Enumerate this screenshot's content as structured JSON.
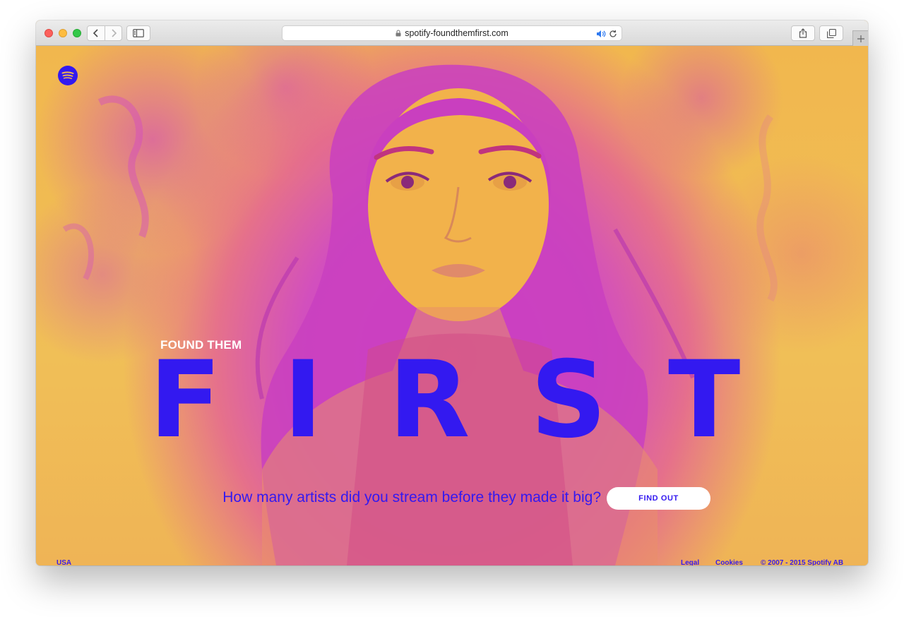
{
  "browser": {
    "url": "spotify-foundthemfirst.com"
  },
  "hero": {
    "eyebrow": "FOUND THEM",
    "headline_letters": [
      "F",
      "I",
      "R",
      "S",
      "T"
    ],
    "tagline": "How many artists did you stream before they made it big?",
    "cta_label": "FIND OUT"
  },
  "footer": {
    "region": "USA",
    "legal": "Legal",
    "cookies": "Cookies",
    "copyright": "© 2007 - 2015 Spotify AB"
  },
  "colors": {
    "brand_blue": "#3319f0",
    "background_yellow": "#f0b64e",
    "magenta": "#d93fd0"
  },
  "icons": [
    "spotify-logo-icon",
    "back-icon",
    "forward-icon",
    "sidebar-icon",
    "lock-icon",
    "audio-icon",
    "reload-icon",
    "share-icon",
    "tabs-icon",
    "new-tab-icon"
  ]
}
